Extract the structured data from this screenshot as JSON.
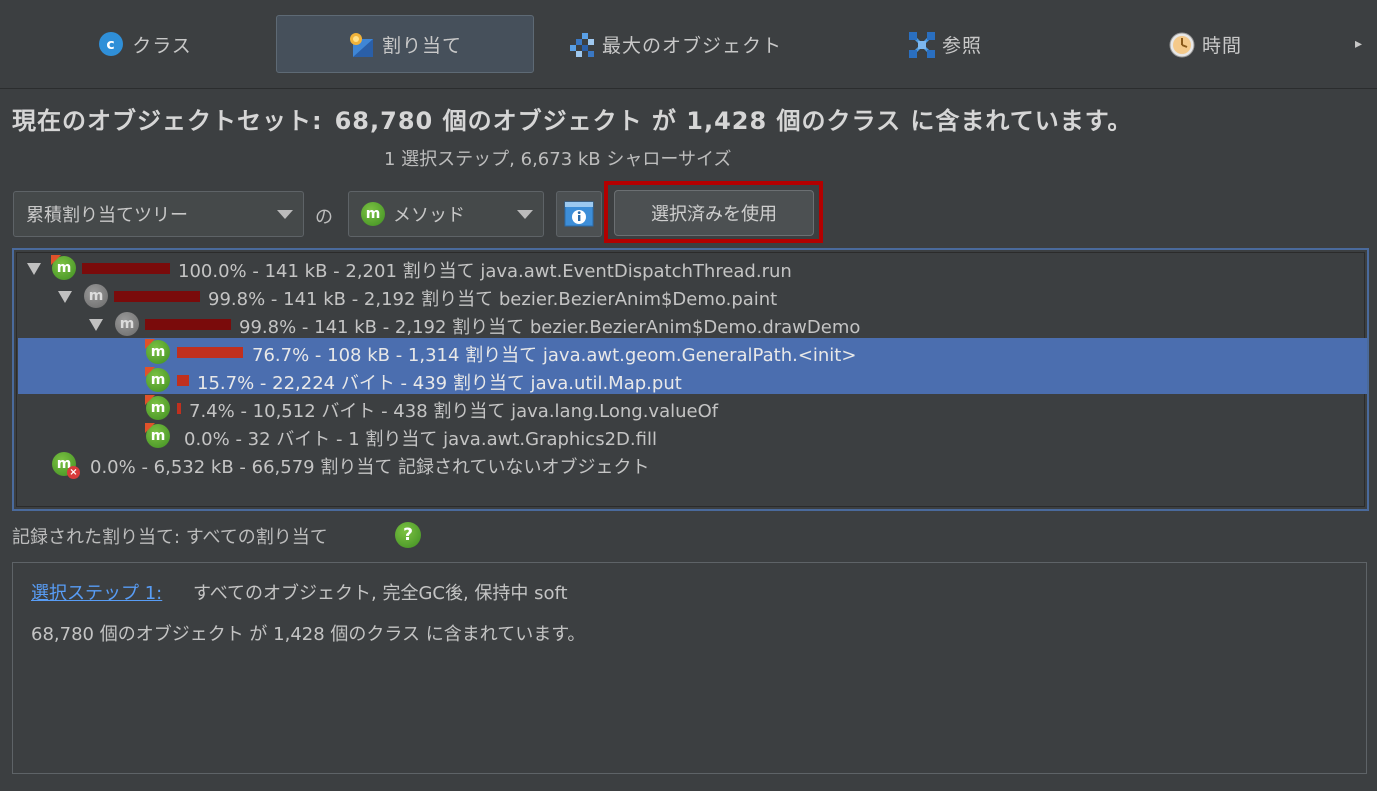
{
  "tabs": [
    {
      "label": "クラス",
      "icon": "class-c-icon"
    },
    {
      "label": "割り当て",
      "icon": "allocation-icon",
      "active": true
    },
    {
      "label": "最大のオブジェクト",
      "icon": "biggest-objects-icon"
    },
    {
      "label": "参照",
      "icon": "references-icon"
    },
    {
      "label": "時間",
      "icon": "clock-icon"
    }
  ],
  "tab_more": "▸",
  "headline": {
    "prefix": "現在のオブジェクトセット:",
    "body": "68,780 個のオブジェクト が 1,428 個のクラス に含まれています。"
  },
  "subline": "1 選択ステップ, 6,673 kB シャローサイズ",
  "controls": {
    "view_select": "累積割り当てツリー",
    "of_label": "の",
    "granularity_select": "メソッド",
    "granularity_icon_letter": "m",
    "use_selected_button": "選択済みを使用"
  },
  "tree": {
    "rows": [
      {
        "text": "100.0% - 141 kB - 2,201 割り当て java.awt.EventDispatchThread.run",
        "share": 1.0
      },
      {
        "text": "99.8% - 141 kB - 2,192 割り当て bezier.BezierAnim$Demo.paint",
        "share": 0.998
      },
      {
        "text": "99.8% - 141 kB - 2,192 割り当て bezier.BezierAnim$Demo.drawDemo",
        "share": 0.998
      },
      {
        "text": "76.7% - 108 kB - 1,314 割り当て java.awt.geom.GeneralPath.<init>",
        "share": 0.767
      },
      {
        "text": "15.7% - 22,224 バイト - 439 割り当て java.util.Map.put",
        "share": 0.157
      },
      {
        "text": "7.4% - 10,512 バイト - 438 割り当て java.lang.Long.valueOf",
        "share": 0.074
      },
      {
        "text": "0.0% - 32 バイト - 1 割り当て java.awt.Graphics2D.fill",
        "share": 0.0
      },
      {
        "text": "0.0% - 6,532 kB - 66,579 割り当て 記録されていないオブジェクト",
        "share": 0.0
      }
    ],
    "method_icon_letter": "m",
    "unrecorded_icon_mark": "×"
  },
  "recorded": {
    "label": "記録された割り当て: すべての割り当て",
    "help": "?"
  },
  "info": {
    "step_link": "選択ステップ 1:",
    "step_desc": "すべてのオブジェクト, 完全GC後, 保持中 soft",
    "summary": "68,780 個のオブジェクト が 1,428 個のクラス に含まれています。"
  },
  "colors": {
    "background": "#3c3f41",
    "selection": "#4b6eaf",
    "highlight_frame": "#b30000",
    "link": "#589df6",
    "bar_dark": "#7a0b0b",
    "bar_red": "#c0301e"
  }
}
